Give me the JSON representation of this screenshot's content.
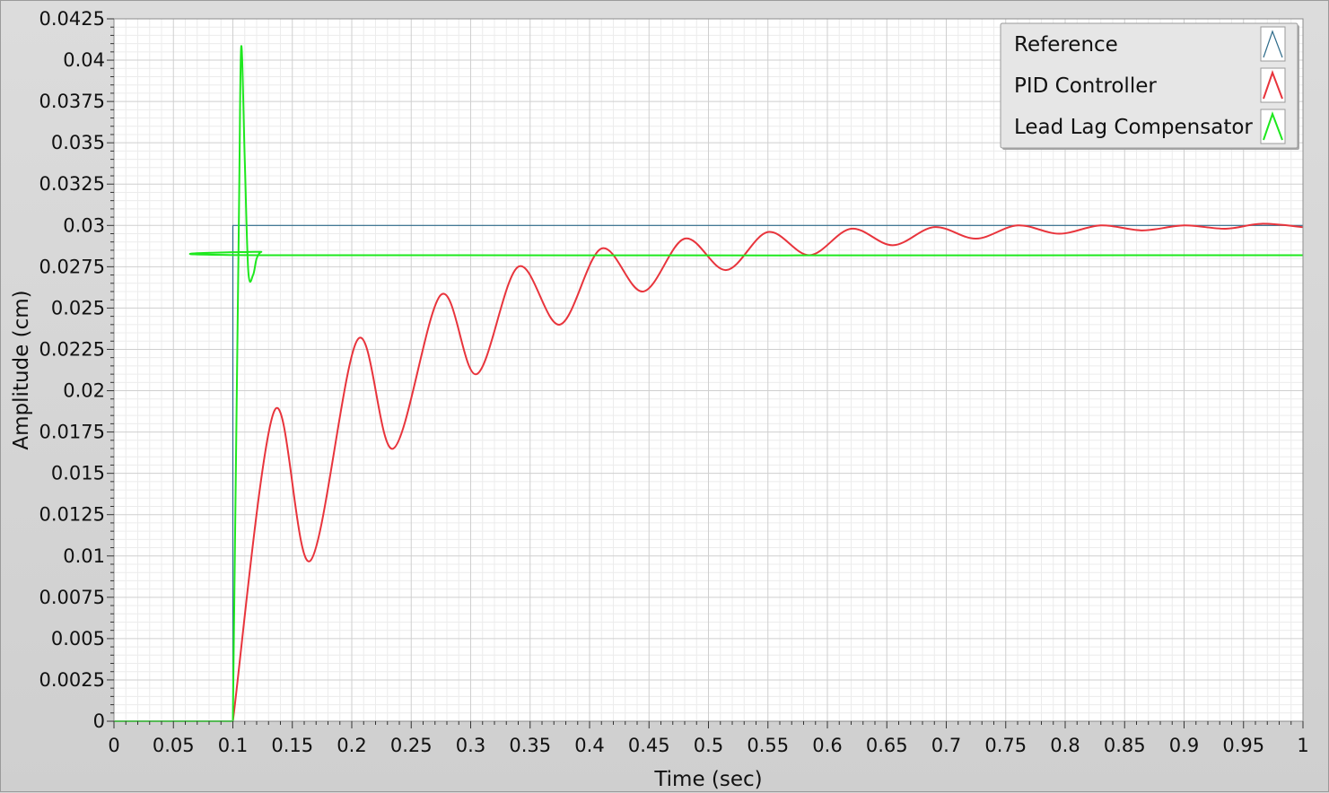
{
  "chart_data": {
    "type": "line",
    "xlabel": "Time (sec)",
    "ylabel": "Amplitude (cm)",
    "xlim": [
      0,
      1
    ],
    "ylim": [
      0,
      0.0425
    ],
    "x_ticks": [
      "0",
      "0.05",
      "0.1",
      "0.15",
      "0.2",
      "0.25",
      "0.3",
      "0.35",
      "0.4",
      "0.45",
      "0.5",
      "0.55",
      "0.6",
      "0.65",
      "0.7",
      "0.75",
      "0.8",
      "0.85",
      "0.9",
      "0.95",
      "1"
    ],
    "y_ticks": [
      "0",
      "0.0025",
      "0.005",
      "0.0075",
      "0.01",
      "0.0125",
      "0.015",
      "0.0175",
      "0.02",
      "0.0225",
      "0.025",
      "0.0275",
      "0.03",
      "0.0325",
      "0.035",
      "0.0375",
      "0.04",
      "0.0425"
    ],
    "grid": true,
    "legend_position": "top-right",
    "series": [
      {
        "name": "Reference",
        "color": "#2e6b8a",
        "x": [
          0,
          0.1,
          0.1,
          1.0
        ],
        "y": [
          0,
          0,
          0.03,
          0.03
        ]
      },
      {
        "name": "PID Controller",
        "color": "#e8343c",
        "x": [
          0,
          0.1,
          0.135,
          0.165,
          0.205,
          0.235,
          0.275,
          0.305,
          0.34,
          0.375,
          0.41,
          0.445,
          0.48,
          0.515,
          0.55,
          0.585,
          0.62,
          0.655,
          0.69,
          0.725,
          0.76,
          0.795,
          0.83,
          0.865,
          0.9,
          0.935,
          0.965,
          1.0
        ],
        "y": [
          0,
          0,
          0.0188,
          0.0097,
          0.0231,
          0.0165,
          0.0258,
          0.021,
          0.0275,
          0.024,
          0.0286,
          0.026,
          0.0292,
          0.0273,
          0.0296,
          0.0282,
          0.0298,
          0.0288,
          0.0299,
          0.0292,
          0.03,
          0.0295,
          0.03,
          0.0297,
          0.03,
          0.0298,
          0.0301,
          0.0299
        ]
      },
      {
        "name": "Lead Lag Compensator",
        "color": "#1ee81e",
        "x": [
          0,
          0.1,
          0.105,
          0.107,
          0.11,
          0.113,
          0.117,
          0.12,
          0.124,
          0.13,
          1.0
        ],
        "y": [
          0,
          0,
          0.03,
          0.0408,
          0.034,
          0.0272,
          0.027,
          0.028,
          0.0284,
          0.0282,
          0.0282
        ]
      }
    ]
  }
}
